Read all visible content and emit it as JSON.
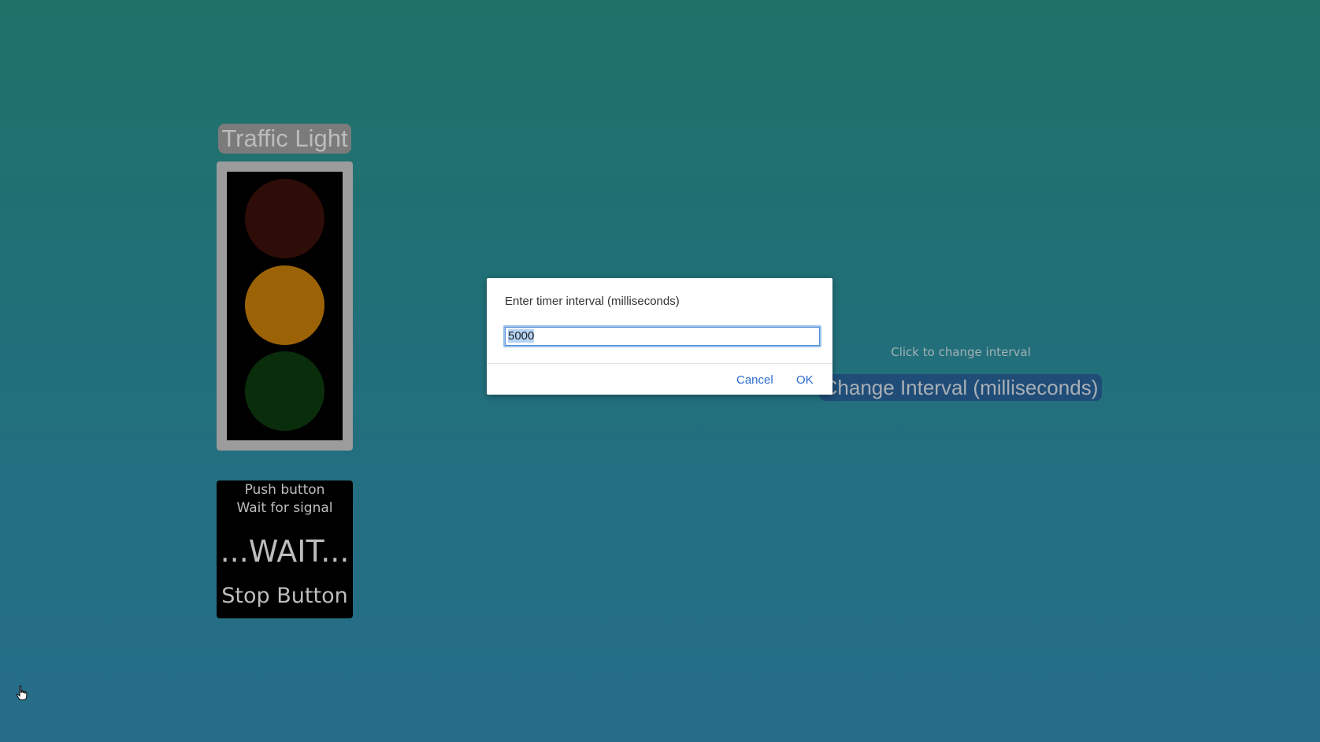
{
  "traffic_light": {
    "title": "Traffic Light",
    "lamps": {
      "red": "#2e0c07",
      "amber": "#9c6306",
      "green": "#0a2d0c"
    }
  },
  "pedestrian": {
    "line1": "Push button",
    "line2": "Wait for signal",
    "status": "...WAIT...",
    "stop_button": "Stop Button"
  },
  "interval": {
    "hint": "Click to change interval",
    "button_label": "Change Interval (milliseconds)"
  },
  "dialog": {
    "message": "Enter timer interval (milliseconds)",
    "input_value": "5000",
    "cancel_label": "Cancel",
    "ok_label": "OK"
  },
  "icons": {
    "cursor": "hand-pointer-icon"
  }
}
